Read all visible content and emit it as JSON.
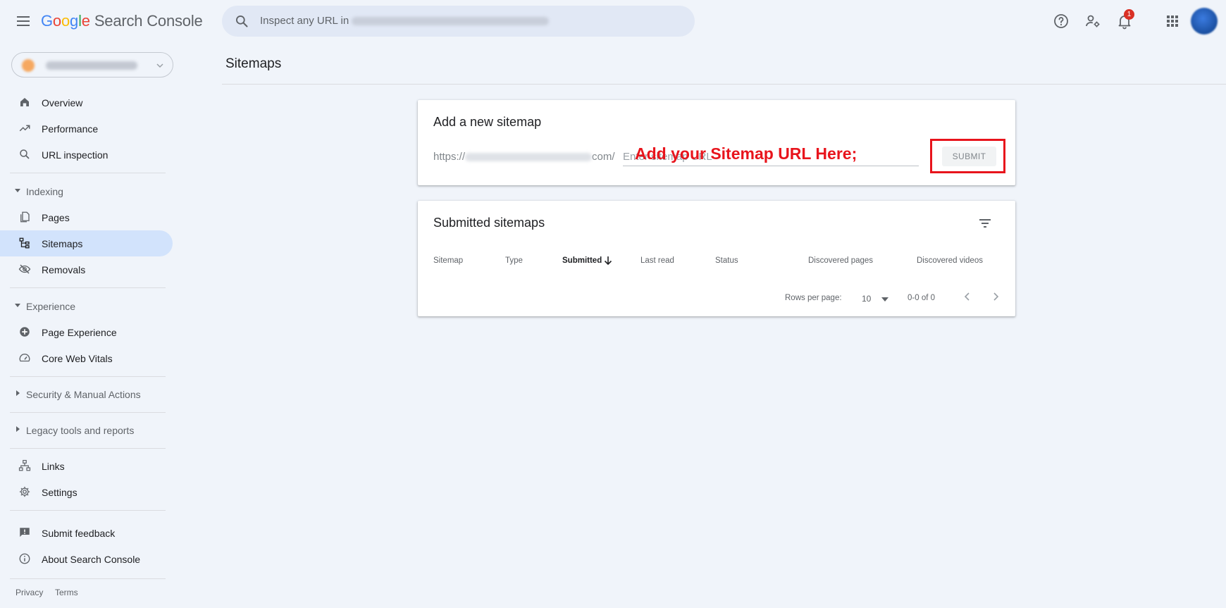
{
  "header": {
    "logo_letters": [
      "G",
      "o",
      "o",
      "g",
      "l",
      "e"
    ],
    "product_name": "Search Console",
    "search_placeholder": "Inspect any URL in",
    "notification_count": "1",
    "icons": [
      "menu-icon",
      "search-icon",
      "help-icon",
      "user-settings-icon",
      "notifications-icon",
      "apps-icon"
    ]
  },
  "sidebar": {
    "items": [
      {
        "label": "Overview",
        "icon": "home-icon"
      },
      {
        "label": "Performance",
        "icon": "trending-up-icon"
      },
      {
        "label": "URL inspection",
        "icon": "search-icon"
      },
      {
        "label": "Pages",
        "icon": "pages-icon"
      },
      {
        "label": "Sitemaps",
        "icon": "sitemap-icon"
      },
      {
        "label": "Removals",
        "icon": "visibility-off-icon"
      },
      {
        "label": "Page Experience",
        "icon": "add-circle-icon"
      },
      {
        "label": "Core Web Vitals",
        "icon": "speed-icon"
      },
      {
        "label": "Links",
        "icon": "links-icon"
      },
      {
        "label": "Settings",
        "icon": "gear-icon"
      },
      {
        "label": "Submit feedback",
        "icon": "feedback-icon"
      },
      {
        "label": "About Search Console",
        "icon": "info-icon"
      }
    ],
    "sections": {
      "indexing": "Indexing",
      "experience": "Experience",
      "security": "Security & Manual Actions",
      "legacy": "Legacy tools and reports"
    },
    "footer": {
      "privacy": "Privacy",
      "terms": "Terms"
    },
    "active_item": "Sitemaps"
  },
  "main": {
    "page_title": "Sitemaps",
    "add_card": {
      "title": "Add a new sitemap",
      "url_prefix_start": "https://",
      "url_prefix_end": "com/",
      "input_placeholder": "Enter sitemap URL",
      "submit_label": "SUBMIT",
      "annotation": "Add your Sitemap URL Here;",
      "annotation_color": "#e8141c"
    },
    "submitted_card": {
      "title": "Submitted sitemaps",
      "columns": [
        "Sitemap",
        "Type",
        "Submitted",
        "Last read",
        "Status",
        "Discovered pages",
        "Discovered videos"
      ],
      "sorted_column": "Submitted",
      "rows_per_page_label": "Rows per page:",
      "rows_per_page_value": "10",
      "range": "0-0 of 0"
    }
  },
  "colors": {
    "background": "#f0f4fa",
    "active_nav": "#d2e3fc",
    "accent_blue": "#4285f4",
    "badge_red": "#d93025"
  }
}
